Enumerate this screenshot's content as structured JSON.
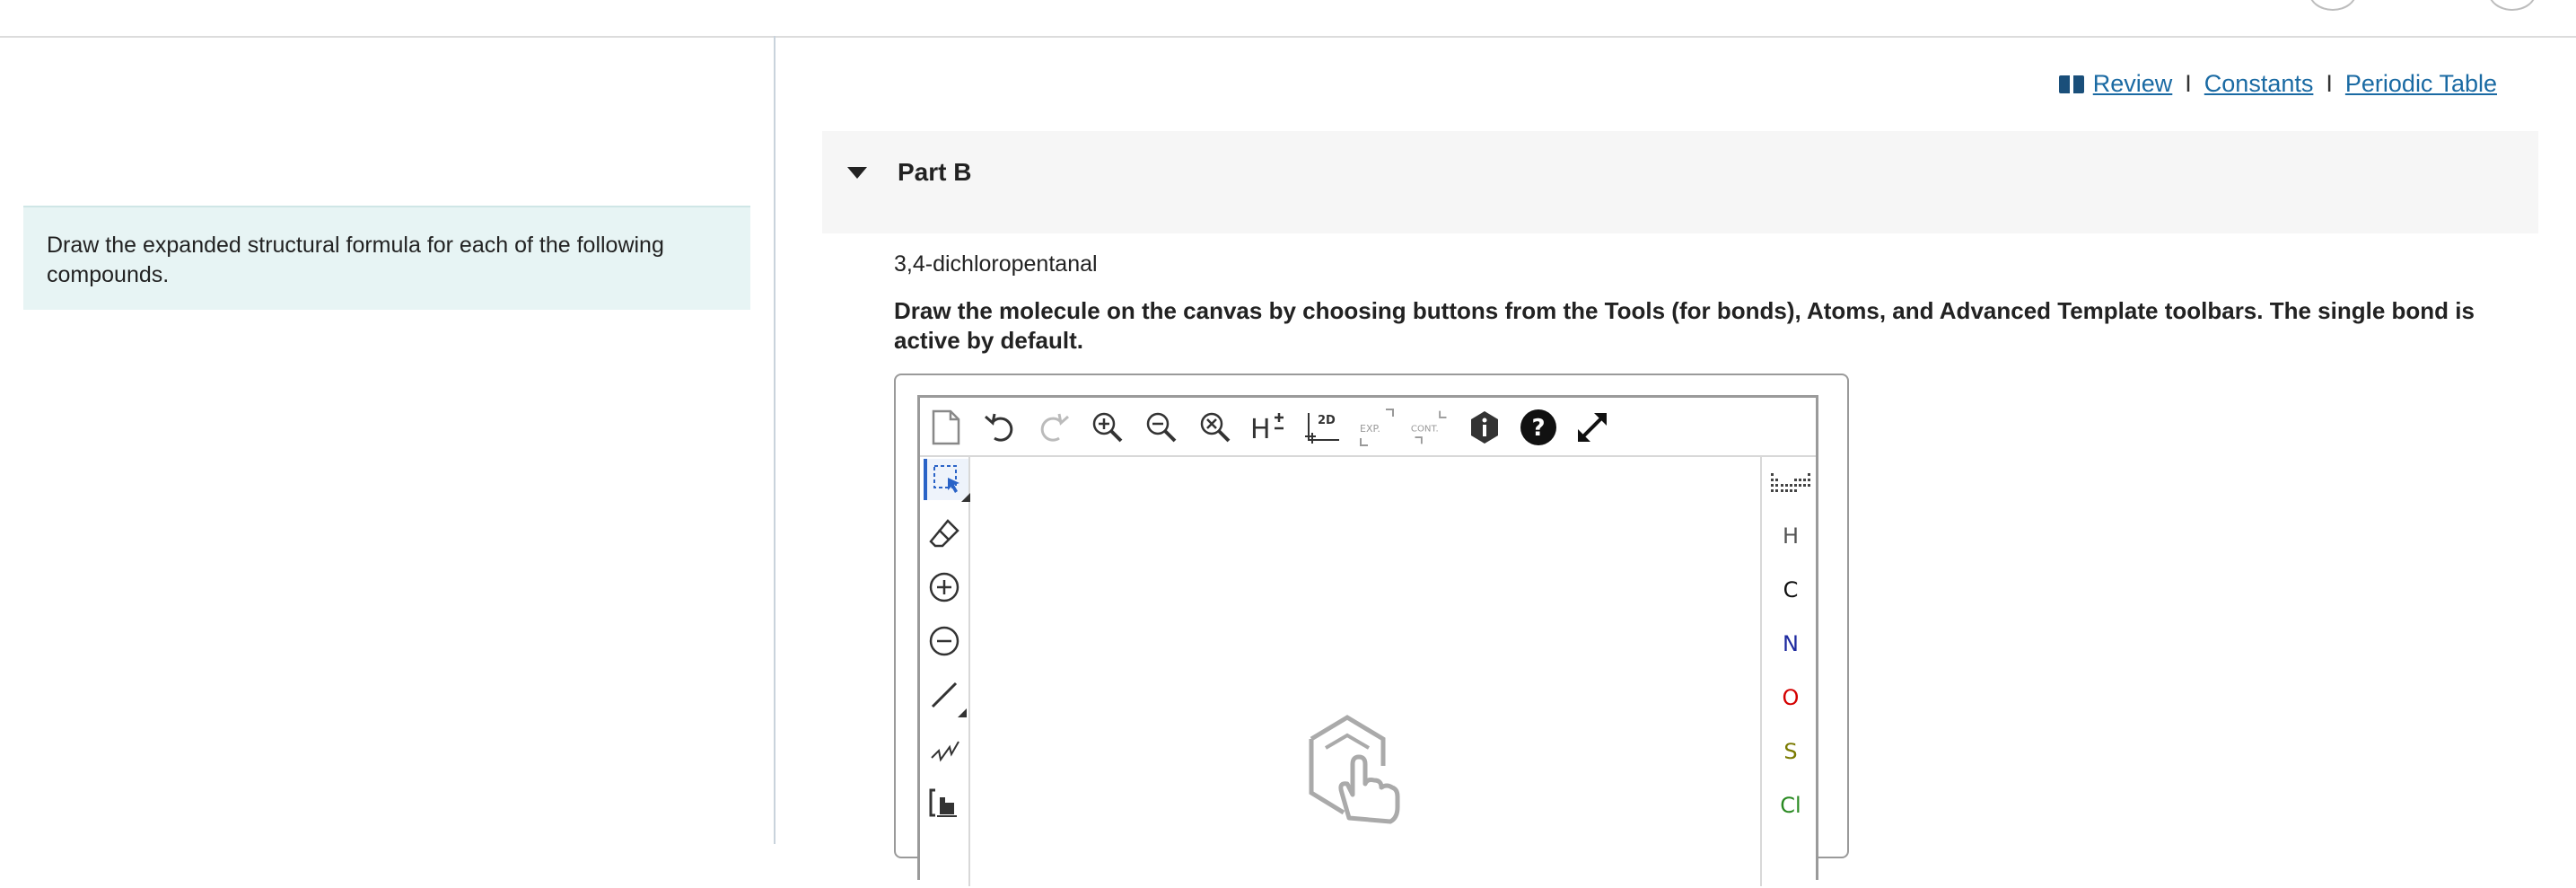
{
  "links": {
    "review": "Review",
    "constants": "Constants",
    "periodic_table": "Periodic Table",
    "separator": "I"
  },
  "instruction": "Draw the expanded structural formula for each of the following compounds.",
  "part": {
    "title": "Part B"
  },
  "compound": "3,4-dichloropentanal",
  "directions": "Draw the molecule on the canvas by choosing buttons from the Tools (for bonds), Atoms, and Advanced Template toolbars. The single bond is active by default.",
  "toolbar": {
    "two_d_label": "2D",
    "exp_label": "EXP.",
    "cont_label": "CONT.",
    "h_label": "H"
  },
  "atoms": [
    {
      "symbol": "H",
      "color": "#555555"
    },
    {
      "symbol": "C",
      "color": "#111111"
    },
    {
      "symbol": "N",
      "color": "#1e2aa0"
    },
    {
      "symbol": "O",
      "color": "#d40000"
    },
    {
      "symbol": "S",
      "color": "#7a7a00"
    },
    {
      "symbol": "Cl",
      "color": "#2a8a22"
    }
  ],
  "colors": {
    "link": "#1a6aa3",
    "instruction_bg": "#e7f4f4",
    "active_tool": "#2a63c7"
  }
}
